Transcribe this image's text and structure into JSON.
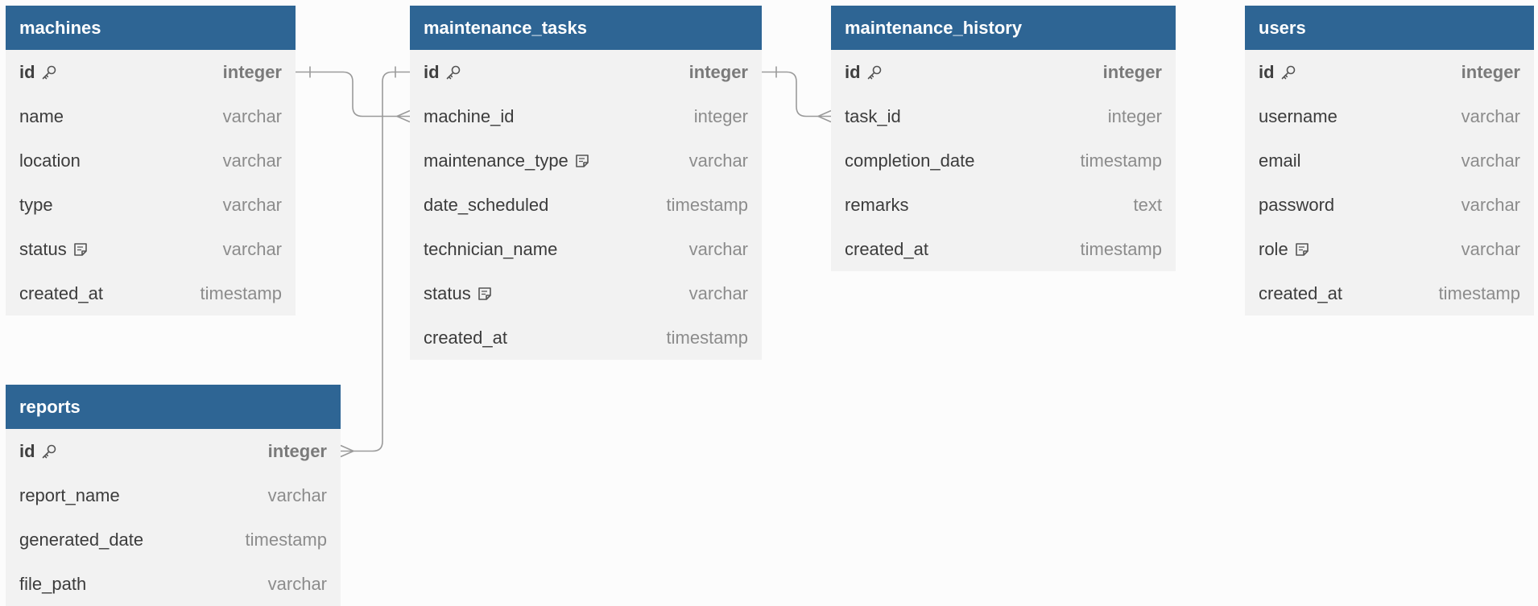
{
  "colors": {
    "header": "#2e6594",
    "body": "#f2f2f2",
    "line": "#9a9a9a"
  },
  "tables": {
    "machines": {
      "name": "machines",
      "fields": [
        {
          "name": "id",
          "type": "integer",
          "pk": true,
          "icon": "key-icon"
        },
        {
          "name": "name",
          "type": "varchar"
        },
        {
          "name": "location",
          "type": "varchar"
        },
        {
          "name": "type",
          "type": "varchar"
        },
        {
          "name": "status",
          "type": "varchar",
          "icon": "note-icon"
        },
        {
          "name": "created_at",
          "type": "timestamp"
        }
      ]
    },
    "maintenance_tasks": {
      "name": "maintenance_tasks",
      "fields": [
        {
          "name": "id",
          "type": "integer",
          "pk": true,
          "icon": "key-icon"
        },
        {
          "name": "machine_id",
          "type": "integer"
        },
        {
          "name": "maintenance_type",
          "type": "varchar",
          "icon": "note-icon"
        },
        {
          "name": "date_scheduled",
          "type": "timestamp"
        },
        {
          "name": "technician_name",
          "type": "varchar"
        },
        {
          "name": "status",
          "type": "varchar",
          "icon": "note-icon"
        },
        {
          "name": "created_at",
          "type": "timestamp"
        }
      ]
    },
    "maintenance_history": {
      "name": "maintenance_history",
      "fields": [
        {
          "name": "id",
          "type": "integer",
          "pk": true,
          "icon": "key-icon"
        },
        {
          "name": "task_id",
          "type": "integer"
        },
        {
          "name": "completion_date",
          "type": "timestamp"
        },
        {
          "name": "remarks",
          "type": "text"
        },
        {
          "name": "created_at",
          "type": "timestamp"
        }
      ]
    },
    "users": {
      "name": "users",
      "fields": [
        {
          "name": "id",
          "type": "integer",
          "pk": true,
          "icon": "key-icon"
        },
        {
          "name": "username",
          "type": "varchar"
        },
        {
          "name": "email",
          "type": "varchar"
        },
        {
          "name": "password",
          "type": "varchar"
        },
        {
          "name": "role",
          "type": "varchar",
          "icon": "note-icon"
        },
        {
          "name": "created_at",
          "type": "timestamp"
        }
      ]
    },
    "reports": {
      "name": "reports",
      "fields": [
        {
          "name": "id",
          "type": "integer",
          "pk": true,
          "icon": "key-icon"
        },
        {
          "name": "report_name",
          "type": "varchar"
        },
        {
          "name": "generated_date",
          "type": "timestamp"
        },
        {
          "name": "file_path",
          "type": "varchar"
        }
      ]
    }
  },
  "relationships": [
    {
      "from": "machines.id",
      "from_card": "one",
      "to": "maintenance_tasks.machine_id",
      "to_card": "many"
    },
    {
      "from": "maintenance_tasks.id",
      "from_card": "one",
      "to": "maintenance_history.task_id",
      "to_card": "many"
    },
    {
      "from": "maintenance_tasks.id",
      "from_card": "one",
      "to": "reports.id",
      "to_card": "many"
    }
  ]
}
